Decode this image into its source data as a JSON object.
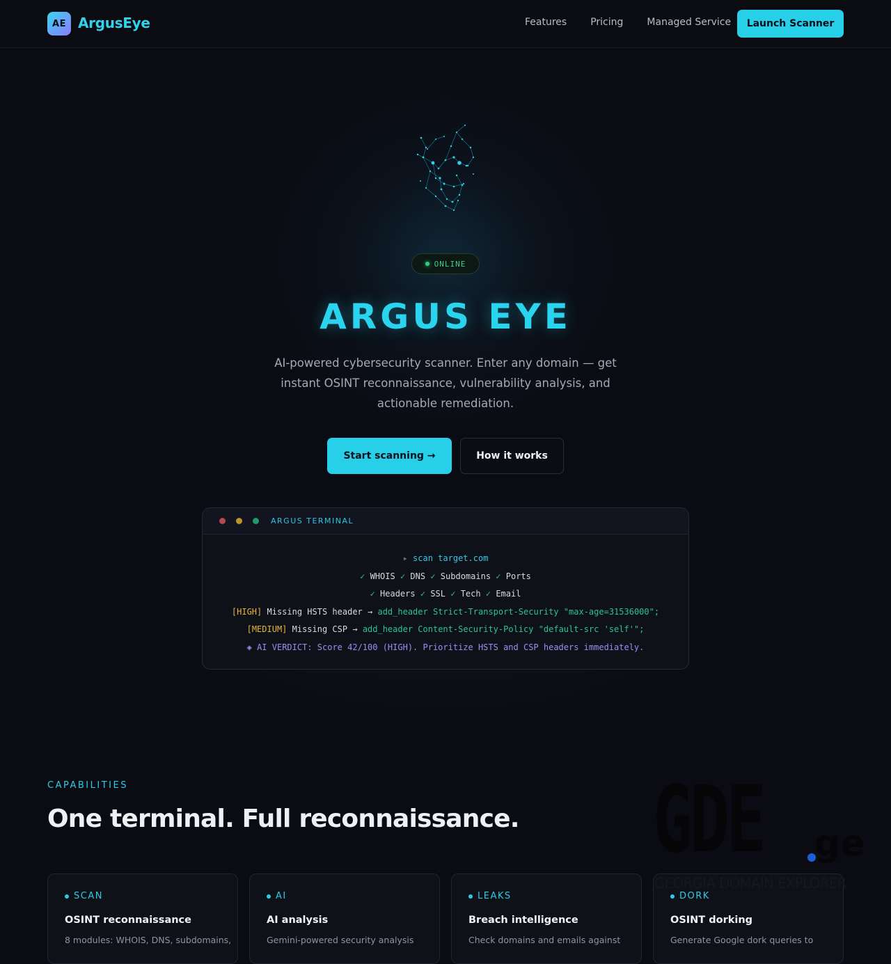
{
  "nav": {
    "logo_badge": "AE",
    "logo_text": "ArgusEye",
    "links": [
      "Features",
      "Pricing",
      "Managed Service"
    ],
    "cta": "Launch Scanner"
  },
  "hero": {
    "status": "ONLINE",
    "title": "ARGUS EYE",
    "subtitle": "AI-powered cybersecurity scanner. Enter any domain — get instant OSINT reconnaissance, vulnerability analysis, and actionable remediation.",
    "primary_button": "Start scanning →",
    "secondary_button": "How it works"
  },
  "terminal": {
    "title": "ARGUS TERMINAL",
    "prompt_symbol": "▸",
    "command": "scan target.com",
    "check_symbol": "✓",
    "checks_line1": [
      "WHOIS",
      "DNS",
      "Subdomains",
      "Ports"
    ],
    "checks_line2": [
      "Headers",
      "SSL",
      "Tech",
      "Email"
    ],
    "finding1": {
      "severity": "[HIGH]",
      "issue": "Missing HSTS header",
      "arrow": "→",
      "fix_cmd": "add_header",
      "fix_arg": "Strict-Transport-Security \"max-age=31536000\";"
    },
    "finding2": {
      "severity": "[MEDIUM]",
      "issue": "Missing CSP",
      "arrow": "→",
      "fix_cmd": "add_header",
      "fix_arg": "Content-Security-Policy \"default-src 'self'\";"
    },
    "verdict_symbol": "◈",
    "verdict": "AI VERDICT: Score 42/100 (HIGH). Prioritize HSTS and CSP headers immediately."
  },
  "capabilities": {
    "label": "CAPABILITIES",
    "title": "One terminal. Full reconnaissance.",
    "cards": [
      {
        "tag": "SCAN",
        "title": "OSINT reconnaissance",
        "desc": "8 modules: WHOIS, DNS, subdomains,"
      },
      {
        "tag": "AI",
        "title": "AI analysis",
        "desc": "Gemini-powered security analysis"
      },
      {
        "tag": "LEAKS",
        "title": "Breach intelligence",
        "desc": "Check domains and emails against"
      },
      {
        "tag": "DORK",
        "title": "OSINT dorking",
        "desc": "Generate Google dork queries to"
      }
    ]
  },
  "watermark": {
    "main": "GDE",
    "suffix": "ge",
    "subtitle": "GEORGIA DOMAIN EXPLORER"
  },
  "colors": {
    "background": "#0b0c13",
    "accent": "#27cfe9",
    "success": "#2fd081",
    "warning": "#e8b53a",
    "ai_purple": "#9c8df5"
  }
}
